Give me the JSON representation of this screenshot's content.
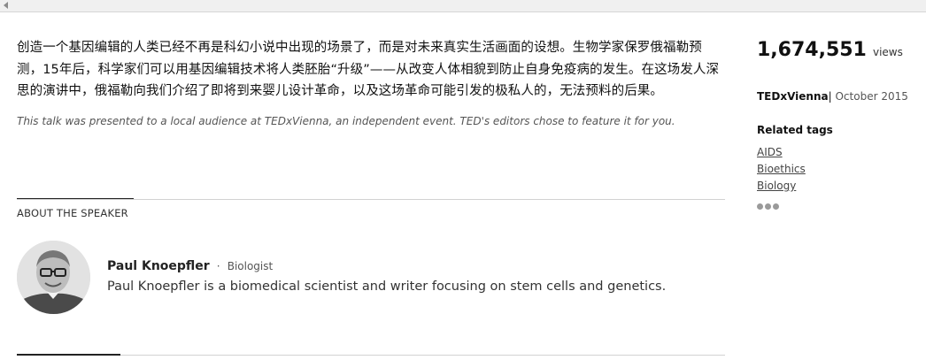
{
  "talk": {
    "description": "创造一个基因编辑的人类已经不再是科幻小说中出现的场景了，而是对未来真实生活画面的设想。生物学家保罗俄福勒预测，15年后，科学家们可以用基因编辑技术将人类胚胎“升级”——从改变人体相貌到防止自身免疫病的发生。在这场发人深思的演讲中，俄福勒向我们介绍了即将到来婴儿设计革命，以及这场革命可能引发的极私人的，无法预料的后果。",
    "note": "This talk was presented to a local audience at TEDxVienna, an independent event. TED's editors chose to feature it for you."
  },
  "speaker_section": {
    "label": "ABOUT THE SPEAKER",
    "name": "Paul Knoepfler",
    "separator": "·",
    "role": "Biologist",
    "bio": "Paul Knoepfler is a biomedical scientist and writer focusing on stem cells and genetics."
  },
  "sidebar": {
    "views_count": "1,674,551",
    "views_label": "views",
    "event_name": "TEDxVienna",
    "event_separator": "|",
    "event_date": "October 2015",
    "tags_title": "Related tags",
    "tags": [
      "AIDS",
      "Bioethics",
      "Biology"
    ],
    "more_icon": "more-dots-icon"
  },
  "colors": {
    "text": "#111111",
    "muted": "#555555",
    "divider": "#d2d2d2",
    "dots": "#9a9a9a"
  }
}
